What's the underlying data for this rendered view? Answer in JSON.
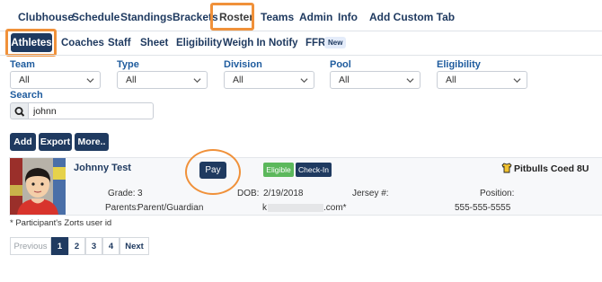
{
  "top_nav": {
    "items": [
      {
        "label": "Clubhouse"
      },
      {
        "label": "Schedule"
      },
      {
        "label": "Standings"
      },
      {
        "label": "Brackets"
      },
      {
        "label": "Roster"
      },
      {
        "label": "Teams"
      },
      {
        "label": "Admin"
      },
      {
        "label": "Info"
      },
      {
        "label": "Add Custom Tab"
      }
    ],
    "active": "Roster"
  },
  "sub_nav": {
    "items": [
      {
        "label": "Athletes"
      },
      {
        "label": "Coaches"
      },
      {
        "label": "Staff"
      },
      {
        "label": "Sheet"
      },
      {
        "label": "Eligibility"
      },
      {
        "label": "Weigh In"
      },
      {
        "label": "Notify"
      },
      {
        "label": "FFR"
      }
    ],
    "new_badge": "New",
    "active": "Athletes"
  },
  "filters": [
    {
      "label": "Team",
      "value": "All"
    },
    {
      "label": "Type",
      "value": "All"
    },
    {
      "label": "Division",
      "value": "All"
    },
    {
      "label": "Pool",
      "value": "All"
    },
    {
      "label": "Eligibility",
      "value": "All"
    }
  ],
  "search": {
    "label": "Search",
    "value": "johnn"
  },
  "actions": {
    "add": "Add",
    "export": "Export",
    "more": "More.."
  },
  "athlete": {
    "name": "Johnny Test",
    "pay_label": "Pay",
    "eligible_label": "Eligible",
    "checkin_label": "Check-In",
    "team": "Pitbulls Coed 8U",
    "grade_label": "Grade:",
    "grade": "3",
    "dob_label": "DOB:",
    "dob": "2/19/2018",
    "jersey_label": "Jersey #:",
    "position_label": "Position:",
    "parents_label": "Parents:",
    "parents": "Parent/Guardian",
    "email_prefix": "k",
    "email_suffix": ".com*",
    "phone": "555-555-5555"
  },
  "footnote": "* Participant's Zorts user id",
  "pagination": {
    "previous": "Previous",
    "pages": [
      "1",
      "2",
      "3",
      "4"
    ],
    "current": "1",
    "next": "Next"
  },
  "colors": {
    "primary": "#1f3a60",
    "highlight": "#f0913a",
    "eligible": "#5cb85c",
    "label": "#1f5c9e"
  }
}
